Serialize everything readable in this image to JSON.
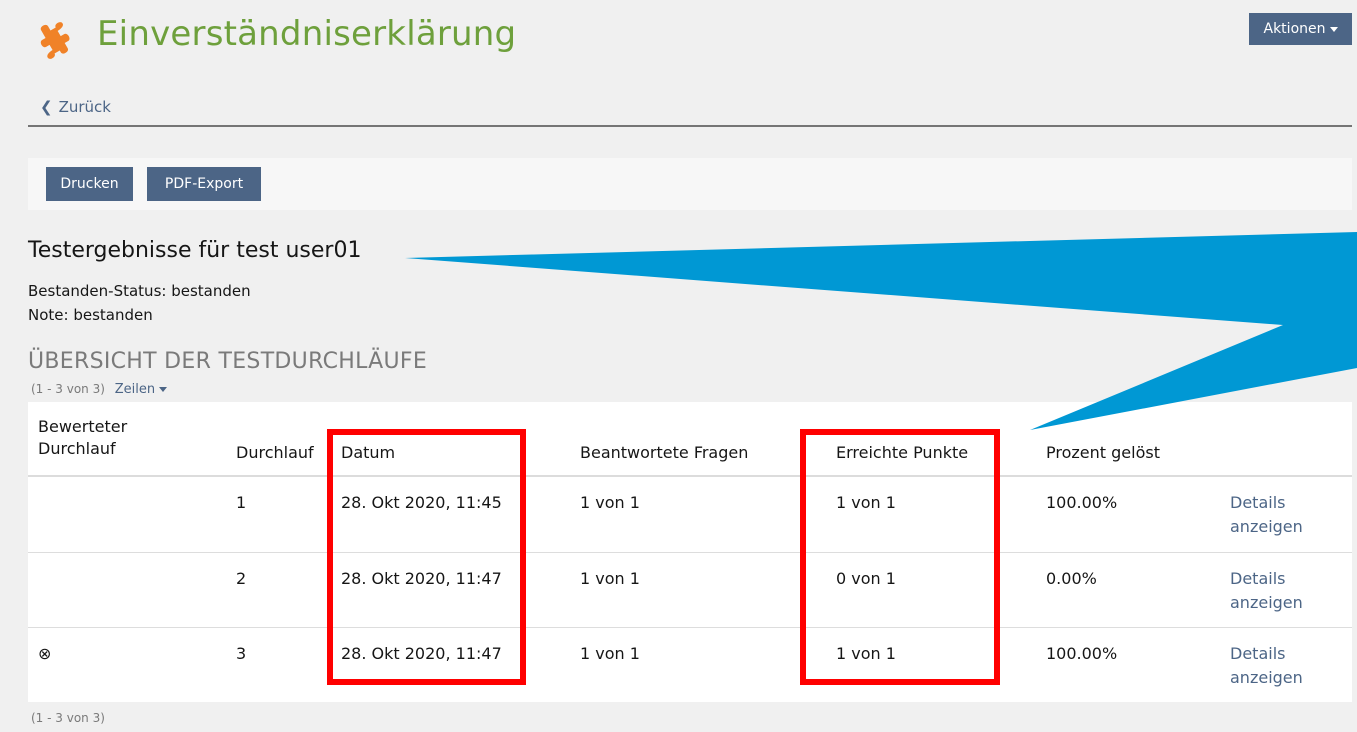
{
  "header": {
    "title": "Einverständniserklärung",
    "actions_label": "Aktionen",
    "back_label": "Zurück",
    "icon": "puzzle-icon"
  },
  "toolbar": {
    "print_label": "Drucken",
    "pdf_label": "PDF-Export"
  },
  "results": {
    "heading": "Testergebnisse für test user01",
    "status": "Bestanden-Status: bestanden",
    "grade": "Note: bestanden"
  },
  "overview": {
    "heading": "ÜBERSICHT DER TESTDURCHLÄUFE",
    "range_top": "(1 - 3 von 3)",
    "rows_label": "Zeilen",
    "range_bottom": "(1 - 3 von 3)"
  },
  "table": {
    "headers": {
      "scored_run": "Bewerteter Durchlauf",
      "run": "Durchlauf",
      "date": "Datum",
      "answered": "Beantwortete Fragen",
      "points": "Erreichte Punkte",
      "percent": "Prozent gelöst"
    },
    "rows": [
      {
        "scored": "",
        "run": "1",
        "date": "28. Okt 2020, 11:45",
        "answered": "1 von 1",
        "points": "1 von 1",
        "percent": "100.00%",
        "details": "Details anzeigen"
      },
      {
        "scored": "",
        "run": "2",
        "date": "28. Okt 2020, 11:47",
        "answered": "1 von 1",
        "points": "0 von 1",
        "percent": "0.00%",
        "details": "Details anzeigen"
      },
      {
        "scored": "⊗",
        "run": "3",
        "date": "28. Okt 2020, 11:47",
        "answered": "1 von 1",
        "points": "1 von 1",
        "percent": "100.00%",
        "details": "Details anzeigen"
      }
    ]
  },
  "colors": {
    "title_green": "#6ea03c",
    "icon_orange": "#f08228",
    "button_blue": "#4c6586",
    "annotation_red": "#ff0000",
    "callout_blue": "#0098d4"
  }
}
